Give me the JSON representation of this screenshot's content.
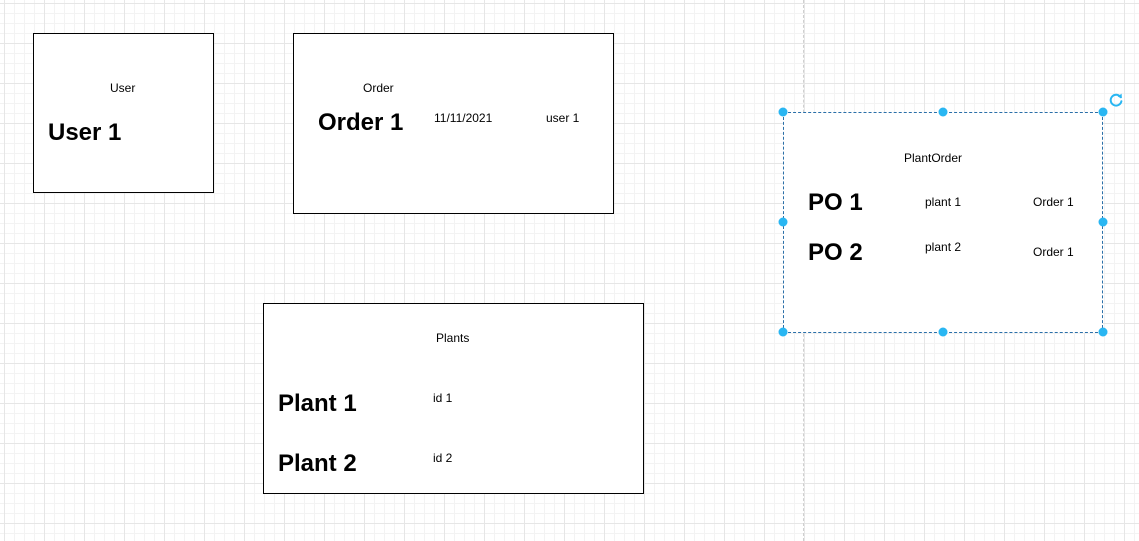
{
  "diagram": {
    "user": {
      "header": "User",
      "rows": [
        {
          "name": "User 1"
        }
      ]
    },
    "order": {
      "header": "Order",
      "rows": [
        {
          "name": "Order 1",
          "date": "11/11/2021",
          "user": "user 1"
        }
      ]
    },
    "plants": {
      "header": "Plants",
      "rows": [
        {
          "name": "Plant 1",
          "id": "id 1"
        },
        {
          "name": "Plant 2",
          "id": "id 2"
        }
      ]
    },
    "plant_order": {
      "header": "PlantOrder",
      "rows": [
        {
          "name": "PO 1",
          "plant": "plant 1",
          "order": "Order 1"
        },
        {
          "name": "PO 2",
          "plant": "plant 2",
          "order": "Order 1"
        }
      ]
    }
  },
  "colors": {
    "selection_handle": "#29b6f2",
    "selection_border": "#2a6fa8"
  },
  "icons": {
    "rotate": "rotate-icon",
    "handle": "resize-handle"
  }
}
